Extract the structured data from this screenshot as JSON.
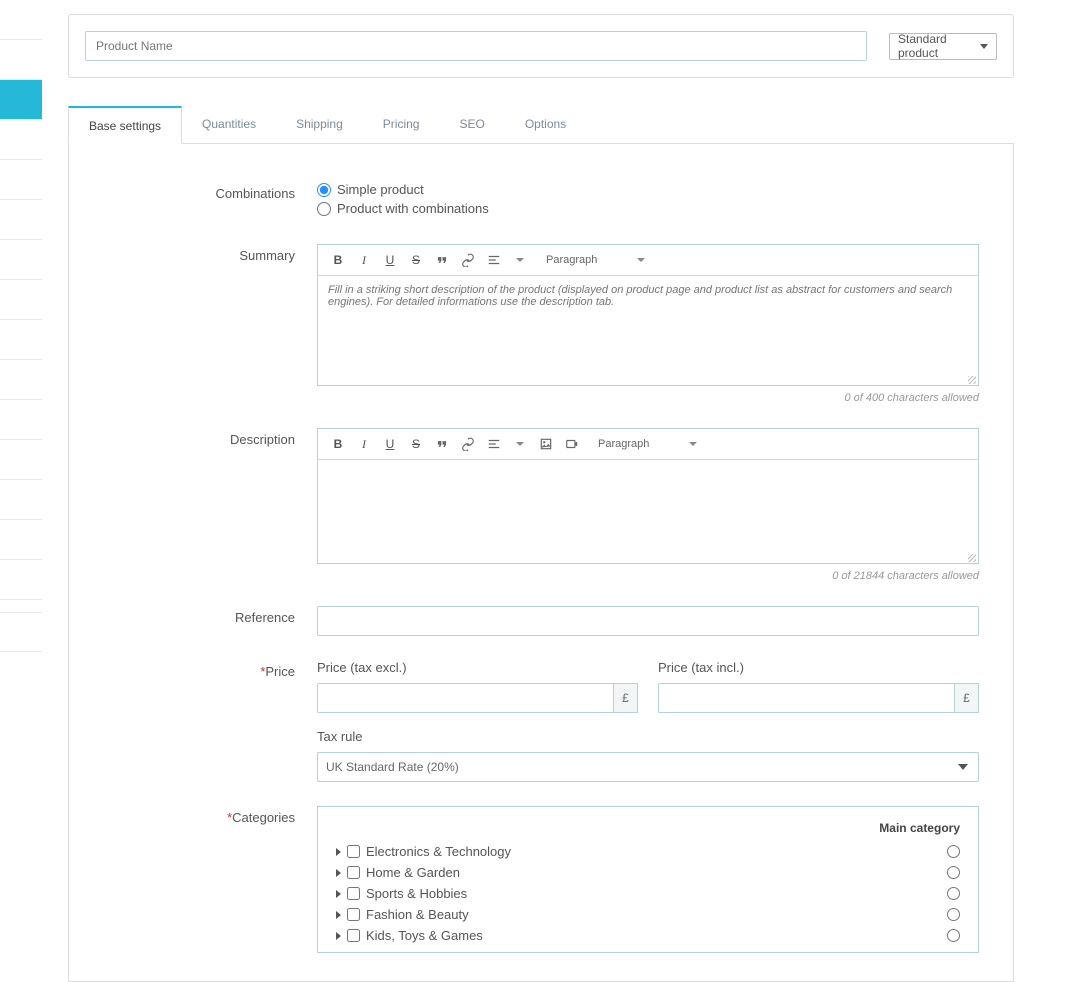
{
  "header": {
    "product_name_placeholder": "Product Name",
    "product_type": "Standard product"
  },
  "tabs": [
    {
      "label": "Base settings",
      "active": true
    },
    {
      "label": "Quantities",
      "active": false
    },
    {
      "label": "Shipping",
      "active": false
    },
    {
      "label": "Pricing",
      "active": false
    },
    {
      "label": "SEO",
      "active": false
    },
    {
      "label": "Options",
      "active": false
    }
  ],
  "labels": {
    "combinations": "Combinations",
    "summary": "Summary",
    "description": "Description",
    "reference": "Reference",
    "price": "Price",
    "categories": "Categories",
    "price_excl": "Price (tax excl.)",
    "price_incl": "Price (tax incl.)",
    "tax_rule": "Tax rule",
    "main_category": "Main category",
    "currency": "£"
  },
  "radios": {
    "simple": "Simple product",
    "combo": "Product with combinations"
  },
  "editor": {
    "paragraph": "Paragraph",
    "summary_placeholder": "Fill in a striking short description of the product (displayed on product page and product list as abstract for customers and search engines). For detailed informations use the description tab.",
    "summary_count": "0 of 400 characters allowed",
    "desc_count": "0 of 21844 characters allowed"
  },
  "tax": {
    "selected": "UK Standard Rate (20%)"
  },
  "categories": [
    {
      "label": "Electronics & Technology"
    },
    {
      "label": "Home & Garden"
    },
    {
      "label": "Sports & Hobbies"
    },
    {
      "label": "Fashion & Beauty"
    },
    {
      "label": "Kids, Toys & Games"
    }
  ]
}
